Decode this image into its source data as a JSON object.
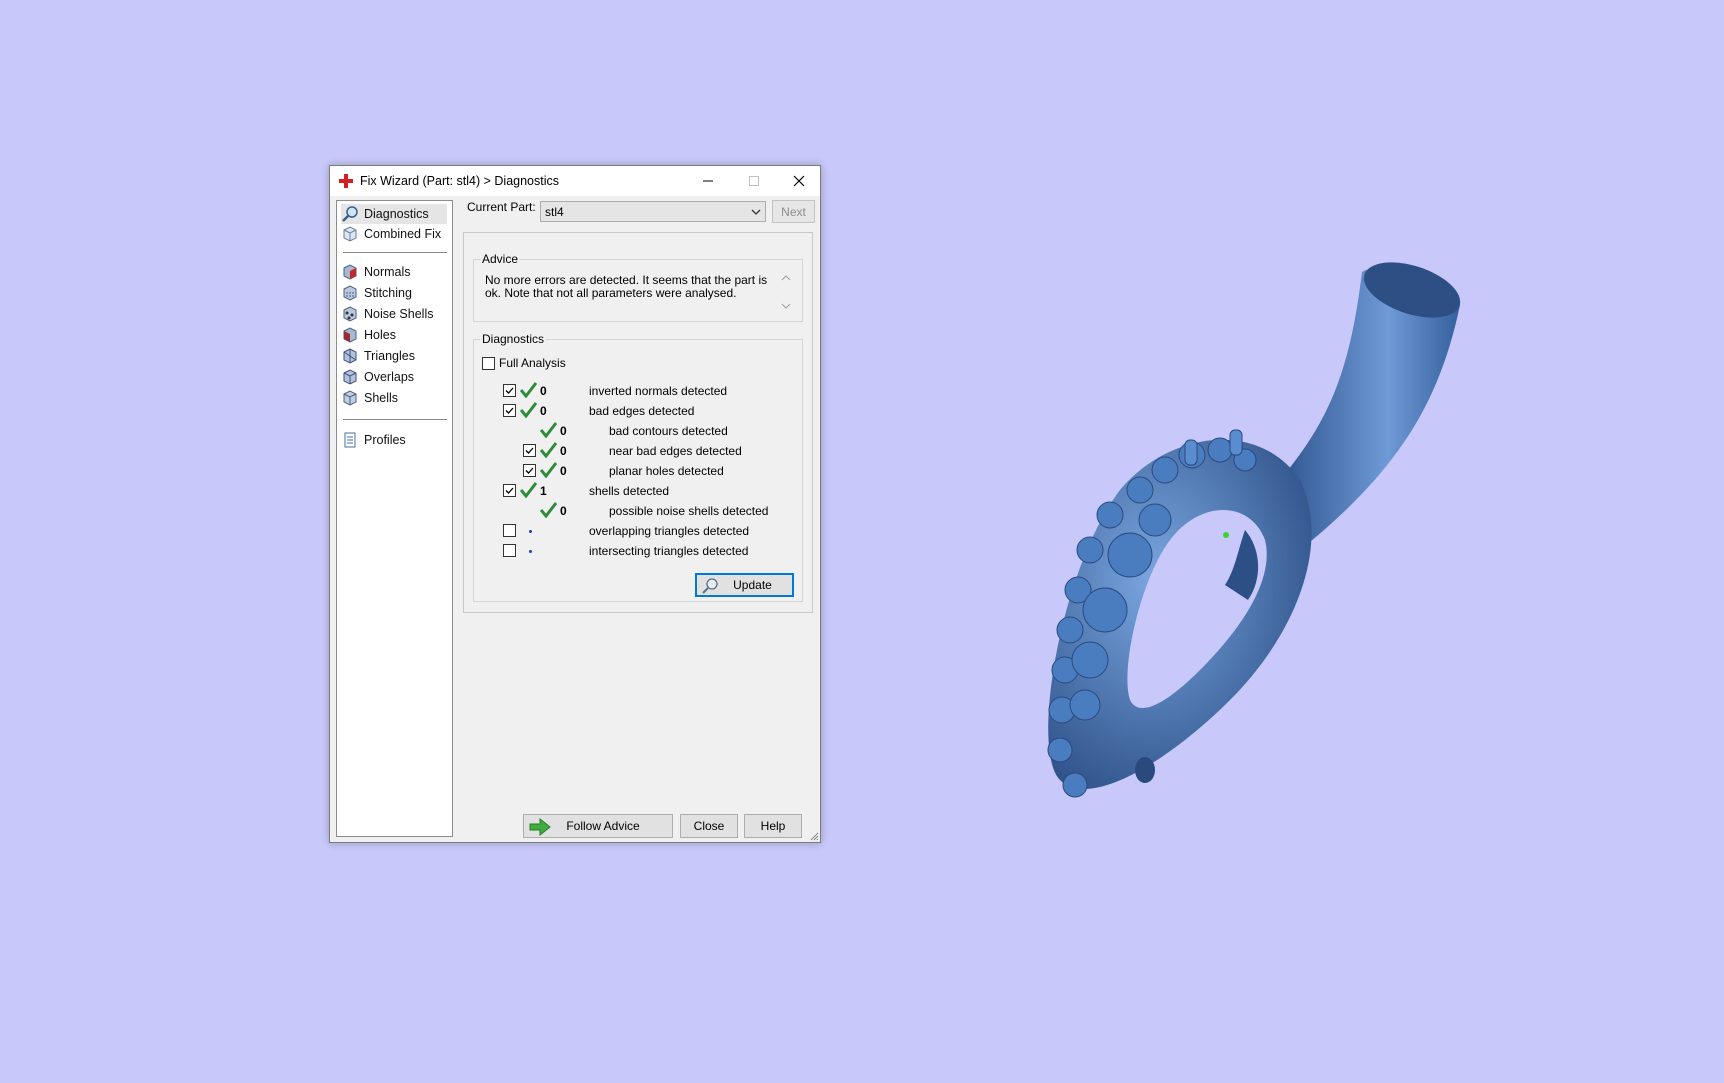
{
  "window": {
    "title": "Fix Wizard (Part: stl4) > Diagnostics"
  },
  "sidebar": {
    "items": [
      {
        "label": "Diagnostics"
      },
      {
        "label": "Combined Fix"
      },
      {
        "label": "Normals"
      },
      {
        "label": "Stitching"
      },
      {
        "label": "Noise Shells"
      },
      {
        "label": "Holes"
      },
      {
        "label": "Triangles"
      },
      {
        "label": "Overlaps"
      },
      {
        "label": "Shells"
      },
      {
        "label": "Profiles"
      }
    ]
  },
  "header": {
    "current_part_label": "Current Part:",
    "current_part_value": "stl4",
    "next_label": "Next"
  },
  "advice": {
    "title": "Advice",
    "text": "No more errors are detected. It seems that the part is ok. Note that not all parameters were analysed."
  },
  "diagnostics": {
    "title": "Diagnostics",
    "full_analysis_label": "Full Analysis",
    "rows": [
      {
        "count": "0",
        "label": "inverted normals detected"
      },
      {
        "count": "0",
        "label": "bad edges detected"
      },
      {
        "count": "0",
        "label": "bad contours detected"
      },
      {
        "count": "0",
        "label": "near bad edges detected"
      },
      {
        "count": "0",
        "label": "planar holes detected"
      },
      {
        "count": "1",
        "label": "shells detected"
      },
      {
        "count": "0",
        "label": "possible noise shells detected"
      },
      {
        "count": "",
        "label": "overlapping triangles detected"
      },
      {
        "count": "",
        "label": "intersecting triangles detected"
      }
    ],
    "update_label": "Update"
  },
  "footer": {
    "follow_advice_label": "Follow Advice",
    "close_label": "Close",
    "help_label": "Help"
  },
  "colors": {
    "background": "#c8c8fa",
    "model": "#3e6fb0",
    "check_green": "#2e8b3a"
  }
}
